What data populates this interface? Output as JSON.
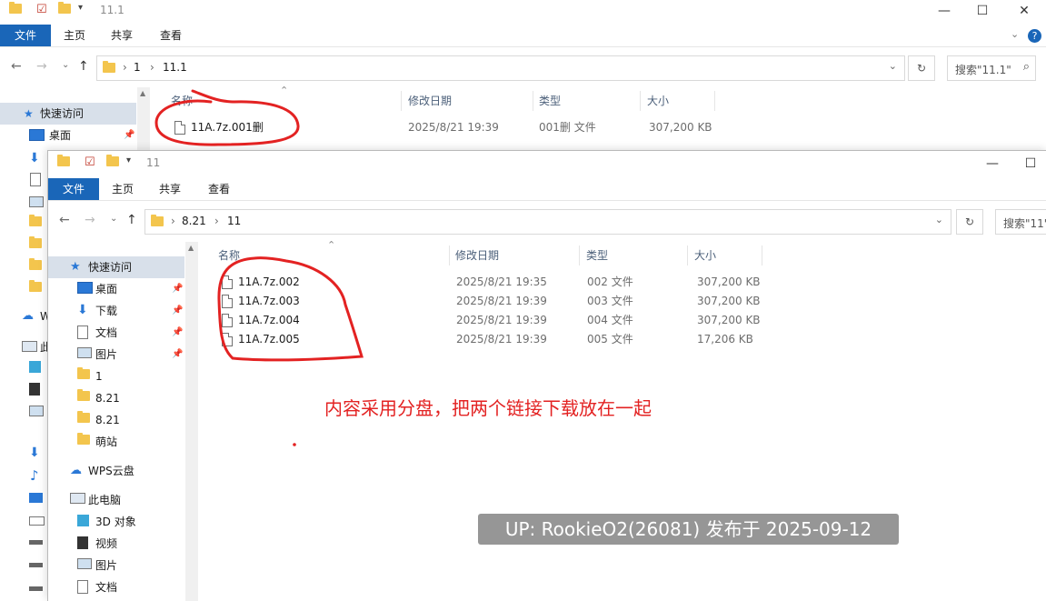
{
  "back_window": {
    "title": "11.1",
    "ribbon_tabs": [
      "文件",
      "主页",
      "共享",
      "查看"
    ],
    "breadcrumb": [
      "1",
      "11.1"
    ],
    "search_placeholder": "搜索\"11.1\"",
    "nav": {
      "quick_access": "快速访问",
      "desktop": "桌面"
    },
    "columns": [
      "名称",
      "修改日期",
      "类型",
      "大小"
    ],
    "files": [
      {
        "name": "11A.7z.001删",
        "date": "2025/8/21 19:39",
        "type": "001删 文件",
        "size": "307,200 KB"
      }
    ],
    "side_fragments": {
      "wps_initial": "W",
      "pc_initial": "此"
    }
  },
  "front_window": {
    "title": "11",
    "ribbon_tabs": [
      "文件",
      "主页",
      "共享",
      "查看"
    ],
    "breadcrumb": [
      "8.21",
      "11"
    ],
    "search_placeholder": "搜索\"11\"",
    "nav": [
      {
        "label": "快速访问",
        "icon": "star-icon",
        "selected": true,
        "pinned": false,
        "indent": false
      },
      {
        "label": "桌面",
        "icon": "desktop-icon",
        "selected": false,
        "pinned": true,
        "indent": true
      },
      {
        "label": "下载",
        "icon": "download-icon",
        "selected": false,
        "pinned": true,
        "indent": true
      },
      {
        "label": "文档",
        "icon": "document-icon",
        "selected": false,
        "pinned": true,
        "indent": true
      },
      {
        "label": "图片",
        "icon": "picture-icon",
        "selected": false,
        "pinned": true,
        "indent": true
      },
      {
        "label": "1",
        "icon": "folder-icon",
        "selected": false,
        "pinned": false,
        "indent": true
      },
      {
        "label": "8.21",
        "icon": "folder-icon",
        "selected": false,
        "pinned": false,
        "indent": true
      },
      {
        "label": "8.21",
        "icon": "folder-icon",
        "selected": false,
        "pinned": false,
        "indent": true
      },
      {
        "label": "萌站",
        "icon": "folder-icon",
        "selected": false,
        "pinned": false,
        "indent": true
      },
      {
        "label": "WPS云盘",
        "icon": "cloud-icon",
        "selected": false,
        "pinned": false,
        "indent": false,
        "gap": true
      },
      {
        "label": "此电脑",
        "icon": "computer-icon",
        "selected": false,
        "pinned": false,
        "indent": false,
        "gap": true
      },
      {
        "label": "3D 对象",
        "icon": "cube-icon",
        "selected": false,
        "pinned": false,
        "indent": true
      },
      {
        "label": "视频",
        "icon": "film-icon",
        "selected": false,
        "pinned": false,
        "indent": true
      },
      {
        "label": "图片",
        "icon": "picture-icon",
        "selected": false,
        "pinned": false,
        "indent": true
      },
      {
        "label": "文档",
        "icon": "document-icon",
        "selected": false,
        "pinned": false,
        "indent": true
      }
    ],
    "columns": [
      "名称",
      "修改日期",
      "类型",
      "大小"
    ],
    "files": [
      {
        "name": "11A.7z.002",
        "date": "2025/8/21 19:35",
        "type": "002 文件",
        "size": "307,200 KB"
      },
      {
        "name": "11A.7z.003",
        "date": "2025/8/21 19:39",
        "type": "003 文件",
        "size": "307,200 KB"
      },
      {
        "name": "11A.7z.004",
        "date": "2025/8/21 19:39",
        "type": "004 文件",
        "size": "307,200 KB"
      },
      {
        "name": "11A.7z.005",
        "date": "2025/8/21 19:39",
        "type": "005 文件",
        "size": "17,206 KB"
      }
    ]
  },
  "annotation": "内容采用分盘，把两个链接下载放在一起",
  "watermark": "UP: RookieO2(26081) 发布于 2025-09-12",
  "colors": {
    "ribbon_file_tab": "#1a66b8",
    "annotation_red": "#e32222",
    "nav_selected": "#d8e0ea"
  }
}
